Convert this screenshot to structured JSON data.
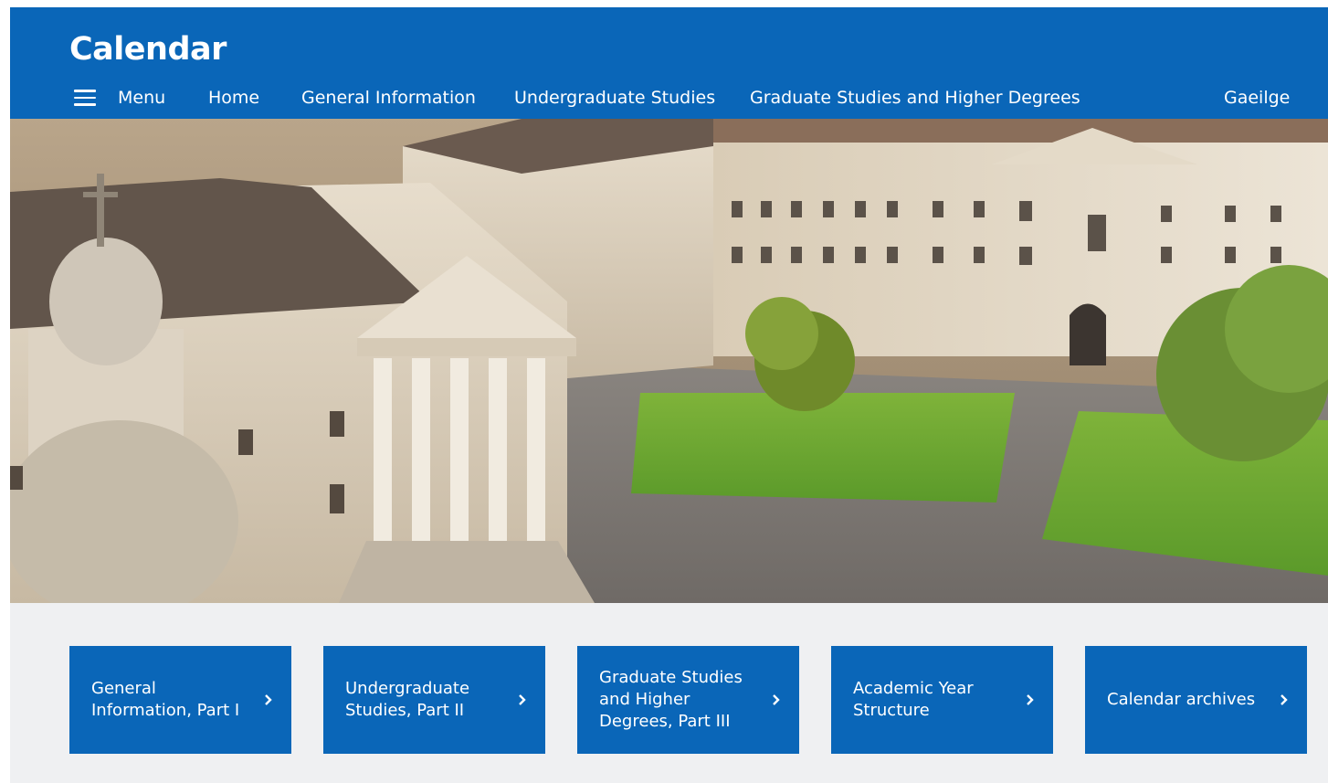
{
  "header": {
    "title": "Calendar",
    "nav": {
      "menu_label": "Menu",
      "items": [
        "Home",
        "General Information",
        "Undergraduate Studies",
        "Graduate Studies and Higher Degrees"
      ],
      "language_link": "Gaeilge"
    }
  },
  "hero": {
    "image": "aerial-photo-campus-front-square",
    "icon": "photo"
  },
  "tiles": [
    {
      "label": "General Information, Part I",
      "icon": "chevron-right-icon"
    },
    {
      "label": "Undergraduate Studies, Part II",
      "icon": "chevron-right-icon"
    },
    {
      "label": "Graduate Studies and Higher Degrees, Part III",
      "icon": "chevron-right-icon"
    },
    {
      "label": "Academic Year Structure",
      "icon": "chevron-right-icon"
    },
    {
      "label": "Calendar archives",
      "icon": "chevron-right-icon"
    }
  ],
  "colors": {
    "brand_blue": "#0a66b8",
    "page_background": "#eff0f2",
    "text_on_brand": "#ffffff"
  }
}
